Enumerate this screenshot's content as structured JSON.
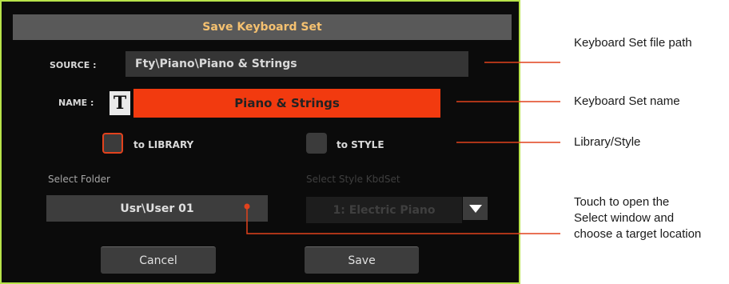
{
  "dialog": {
    "title": "Save Keyboard Set",
    "source_label": "SOURCE :",
    "source_value": "Fty\\Piano\\Piano & Strings",
    "name_label": "NAME :",
    "text_edit_glyph": "T",
    "name_value": "Piano & Strings",
    "to_library_label": "to LIBRARY",
    "to_library_checked": true,
    "to_style_label": "to STYLE",
    "to_style_checked": false,
    "select_folder_label": "Select Folder",
    "folder_value": "Usr\\User 01",
    "select_style_label": "Select Style KbdSet",
    "style_value": "1: Electric Piano",
    "cancel_label": "Cancel",
    "save_label": "Save"
  },
  "callouts": {
    "file_path": "Keyboard Set file path",
    "name": "Keyboard Set name",
    "library_style": "Library/Style",
    "touch_select": "Touch to open the Select window and choose a target location"
  },
  "colors": {
    "frame": "#b7e34a",
    "title_text": "#f5c170",
    "name_field": "#f23a0f",
    "callout_line": "#e2421d"
  }
}
